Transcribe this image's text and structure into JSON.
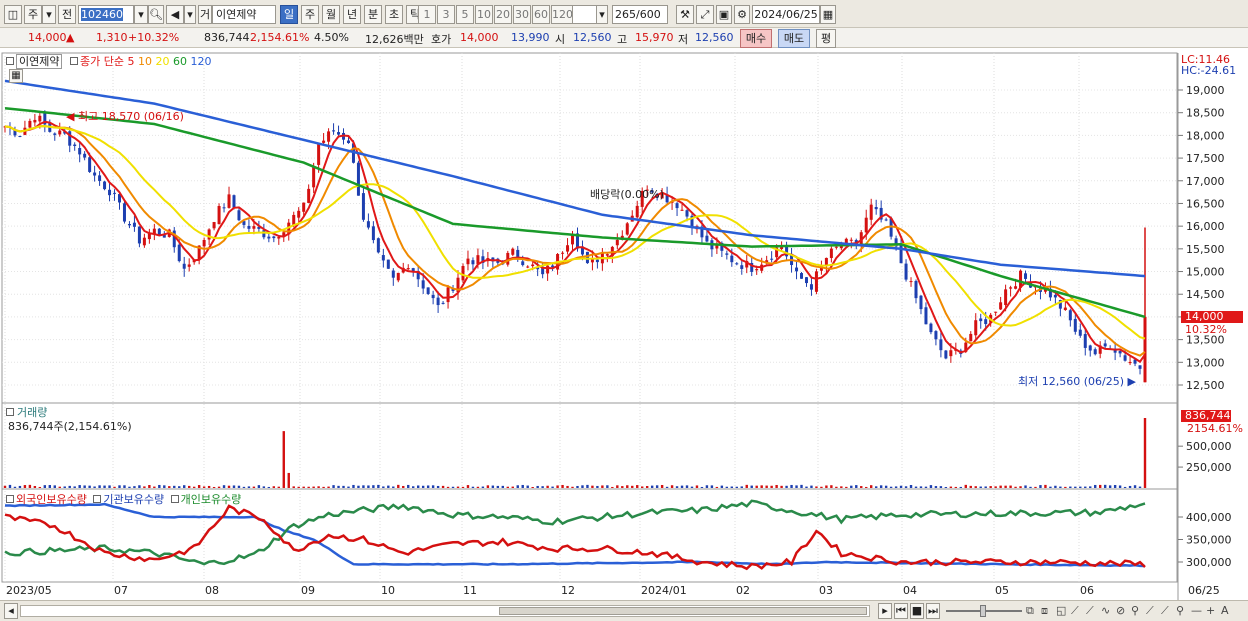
{
  "toolbar": {
    "period_main": "주",
    "prev_label": "전",
    "code": "102460",
    "flag": "거",
    "stock_name": "이연제약",
    "periods": [
      "일",
      "주",
      "월",
      "년",
      "분",
      "초",
      "틱"
    ],
    "active_period": "일",
    "intervals": [
      "1",
      "3",
      "5",
      "10",
      "20",
      "30",
      "60",
      "120"
    ],
    "count": "265",
    "count_total": "/600",
    "date": "2024/06/25"
  },
  "quote": {
    "price": "14,000",
    "arrow": "▲",
    "change": "1,310",
    "change_pct": "+10.32%",
    "volume": "836,744",
    "volume_pct": "2,154.61%",
    "turnover": "4.50%",
    "amount": "12,626백만",
    "bid_label": "호가",
    "ask": "14,000",
    "bid": "13,990",
    "open_label": "시",
    "open": "12,560",
    "high_label": "고",
    "high": "15,970",
    "low_label": "저",
    "low": "12,560",
    "buy_label": "매수",
    "sell_label": "매도",
    "avg_label": "평"
  },
  "price_panel": {
    "stock_name": "이연제약",
    "legend_prefix": "종가 단순",
    "ma_periods": [
      "5",
      "10",
      "20",
      "60",
      "120"
    ],
    "ma_colors": [
      "#e01818",
      "#f08a00",
      "#f0e000",
      "#1a9a2a",
      "#2a5fd6"
    ],
    "y_ticks": [
      "19,000",
      "18,500",
      "18,000",
      "17,500",
      "17,000",
      "16,500",
      "16,000",
      "15,500",
      "15,000",
      "14,500",
      "14,000",
      "13,500",
      "13,000",
      "12,500"
    ],
    "lc": "LC:11.46",
    "hc": "HC:-24.61",
    "last_price_tag": "14,000",
    "last_pct_tag": "10.32%",
    "high_annot": "최고 18,570 (06/16)",
    "low_annot": "최저 12,560 (06/25)",
    "dividend_annot": "배당락(0.00%)"
  },
  "volume_panel": {
    "title": "거래량",
    "value": "836,744주(2,154.61%)",
    "tag_value": "836,744",
    "tag_pct": "2154.61%",
    "y_ticks": [
      "500,000",
      "250,000"
    ]
  },
  "holdings_panel": {
    "series": [
      "외국인보유수량",
      "기관보유수량",
      "개인보유수량"
    ],
    "y_ticks": [
      "400,000",
      "350,000",
      "300,000"
    ]
  },
  "x_axis": [
    "2023/05",
    "07",
    "08",
    "09",
    "10",
    "11",
    "12",
    "2024/01",
    "02",
    "03",
    "04",
    "05",
    "06",
    "06/25"
  ],
  "chart_data": {
    "type": "candlestick",
    "y_range": [
      12300,
      19600
    ],
    "close_path": [
      [
        0,
        18200
      ],
      [
        3,
        18050
      ],
      [
        6,
        18450
      ],
      [
        9,
        18100
      ],
      [
        12,
        18000
      ],
      [
        15,
        17650
      ],
      [
        18,
        17100
      ],
      [
        21,
        16800
      ],
      [
        24,
        16200
      ],
      [
        27,
        15700
      ],
      [
        30,
        15900
      ],
      [
        33,
        15800
      ],
      [
        36,
        15050
      ],
      [
        39,
        15500
      ],
      [
        42,
        16200
      ],
      [
        45,
        16600
      ],
      [
        48,
        16000
      ],
      [
        51,
        15900
      ],
      [
        54,
        15750
      ],
      [
        57,
        16100
      ],
      [
        60,
        16400
      ],
      [
        63,
        17800
      ],
      [
        66,
        18100
      ],
      [
        69,
        17900
      ],
      [
        72,
        16200
      ],
      [
        75,
        15300
      ],
      [
        78,
        14800
      ],
      [
        81,
        15200
      ],
      [
        84,
        14700
      ],
      [
        87,
        14200
      ],
      [
        90,
        14700
      ],
      [
        93,
        15300
      ],
      [
        96,
        15200
      ],
      [
        99,
        15200
      ],
      [
        102,
        15400
      ],
      [
        105,
        15200
      ],
      [
        108,
        14900
      ],
      [
        111,
        15300
      ],
      [
        114,
        15900
      ],
      [
        117,
        15100
      ],
      [
        120,
        15400
      ],
      [
        123,
        15700
      ],
      [
        126,
        16300
      ],
      [
        129,
        16900
      ],
      [
        132,
        16700
      ],
      [
        135,
        16500
      ],
      [
        138,
        16100
      ],
      [
        141,
        15600
      ],
      [
        144,
        15400
      ],
      [
        147,
        15200
      ],
      [
        150,
        15100
      ],
      [
        153,
        15300
      ],
      [
        156,
        15600
      ],
      [
        159,
        14900
      ],
      [
        162,
        14700
      ],
      [
        165,
        15300
      ],
      [
        168,
        15600
      ],
      [
        171,
        15600
      ],
      [
        174,
        16400
      ],
      [
        177,
        16000
      ],
      [
        180,
        15200
      ],
      [
        183,
        14400
      ],
      [
        186,
        13600
      ],
      [
        189,
        13100
      ],
      [
        192,
        13300
      ],
      [
        195,
        13800
      ],
      [
        198,
        14000
      ],
      [
        201,
        14600
      ],
      [
        204,
        14900
      ],
      [
        207,
        14700
      ],
      [
        210,
        14500
      ],
      [
        213,
        14100
      ],
      [
        216,
        13500
      ],
      [
        219,
        13200
      ],
      [
        222,
        13400
      ],
      [
        225,
        13100
      ],
      [
        228,
        12900
      ],
      [
        229,
        14000
      ]
    ],
    "ma5_note": "moving averages 5/10/20/60/120",
    "ma60": [
      [
        0,
        18600
      ],
      [
        30,
        18250
      ],
      [
        60,
        17400
      ],
      [
        90,
        16050
      ],
      [
        120,
        15750
      ],
      [
        150,
        15550
      ],
      [
        180,
        15600
      ],
      [
        200,
        14900
      ],
      [
        229,
        14000
      ]
    ],
    "ma120": [
      [
        0,
        19200
      ],
      [
        30,
        18700
      ],
      [
        60,
        17900
      ],
      [
        90,
        17100
      ],
      [
        120,
        16250
      ],
      [
        150,
        15800
      ],
      [
        180,
        15500
      ],
      [
        200,
        15150
      ],
      [
        229,
        14900
      ]
    ],
    "volume_spikes": [
      [
        56,
        680000
      ],
      [
        229,
        836744
      ]
    ],
    "holdings": {
      "foreign": [
        [
          0,
          400000
        ],
        [
          10,
          380000
        ],
        [
          20,
          320000
        ],
        [
          30,
          305000
        ],
        [
          38,
          330000
        ],
        [
          45,
          420000
        ],
        [
          52,
          395000
        ],
        [
          58,
          325000
        ],
        [
          65,
          360000
        ],
        [
          72,
          350000
        ],
        [
          80,
          320000
        ],
        [
          90,
          340000
        ],
        [
          100,
          345000
        ],
        [
          110,
          330000
        ],
        [
          120,
          330000
        ],
        [
          130,
          320000
        ],
        [
          140,
          300000
        ],
        [
          150,
          290000
        ],
        [
          158,
          300000
        ],
        [
          163,
          370000
        ],
        [
          168,
          320000
        ],
        [
          180,
          300000
        ],
        [
          200,
          300000
        ],
        [
          210,
          300000
        ],
        [
          229,
          295000
        ]
      ],
      "institution": [
        [
          0,
          425000
        ],
        [
          20,
          428000
        ],
        [
          30,
          400000
        ],
        [
          50,
          400000
        ],
        [
          56,
          370000
        ],
        [
          62,
          350000
        ],
        [
          70,
          295000
        ],
        [
          100,
          295000
        ],
        [
          140,
          300000
        ],
        [
          155,
          295000
        ],
        [
          165,
          300000
        ],
        [
          200,
          295000
        ],
        [
          229,
          292000
        ]
      ],
      "individual": [
        [
          0,
          320000
        ],
        [
          10,
          325000
        ],
        [
          20,
          330000
        ],
        [
          30,
          320000
        ],
        [
          40,
          295000
        ],
        [
          50,
          315000
        ],
        [
          58,
          380000
        ],
        [
          65,
          405000
        ],
        [
          72,
          415000
        ],
        [
          80,
          425000
        ],
        [
          90,
          405000
        ],
        [
          100,
          400000
        ],
        [
          110,
          390000
        ],
        [
          120,
          400000
        ],
        [
          130,
          410000
        ],
        [
          140,
          415000
        ],
        [
          150,
          430000
        ],
        [
          160,
          410000
        ],
        [
          168,
          395000
        ],
        [
          180,
          405000
        ],
        [
          200,
          408000
        ],
        [
          220,
          410000
        ],
        [
          229,
          430000
        ]
      ]
    }
  }
}
